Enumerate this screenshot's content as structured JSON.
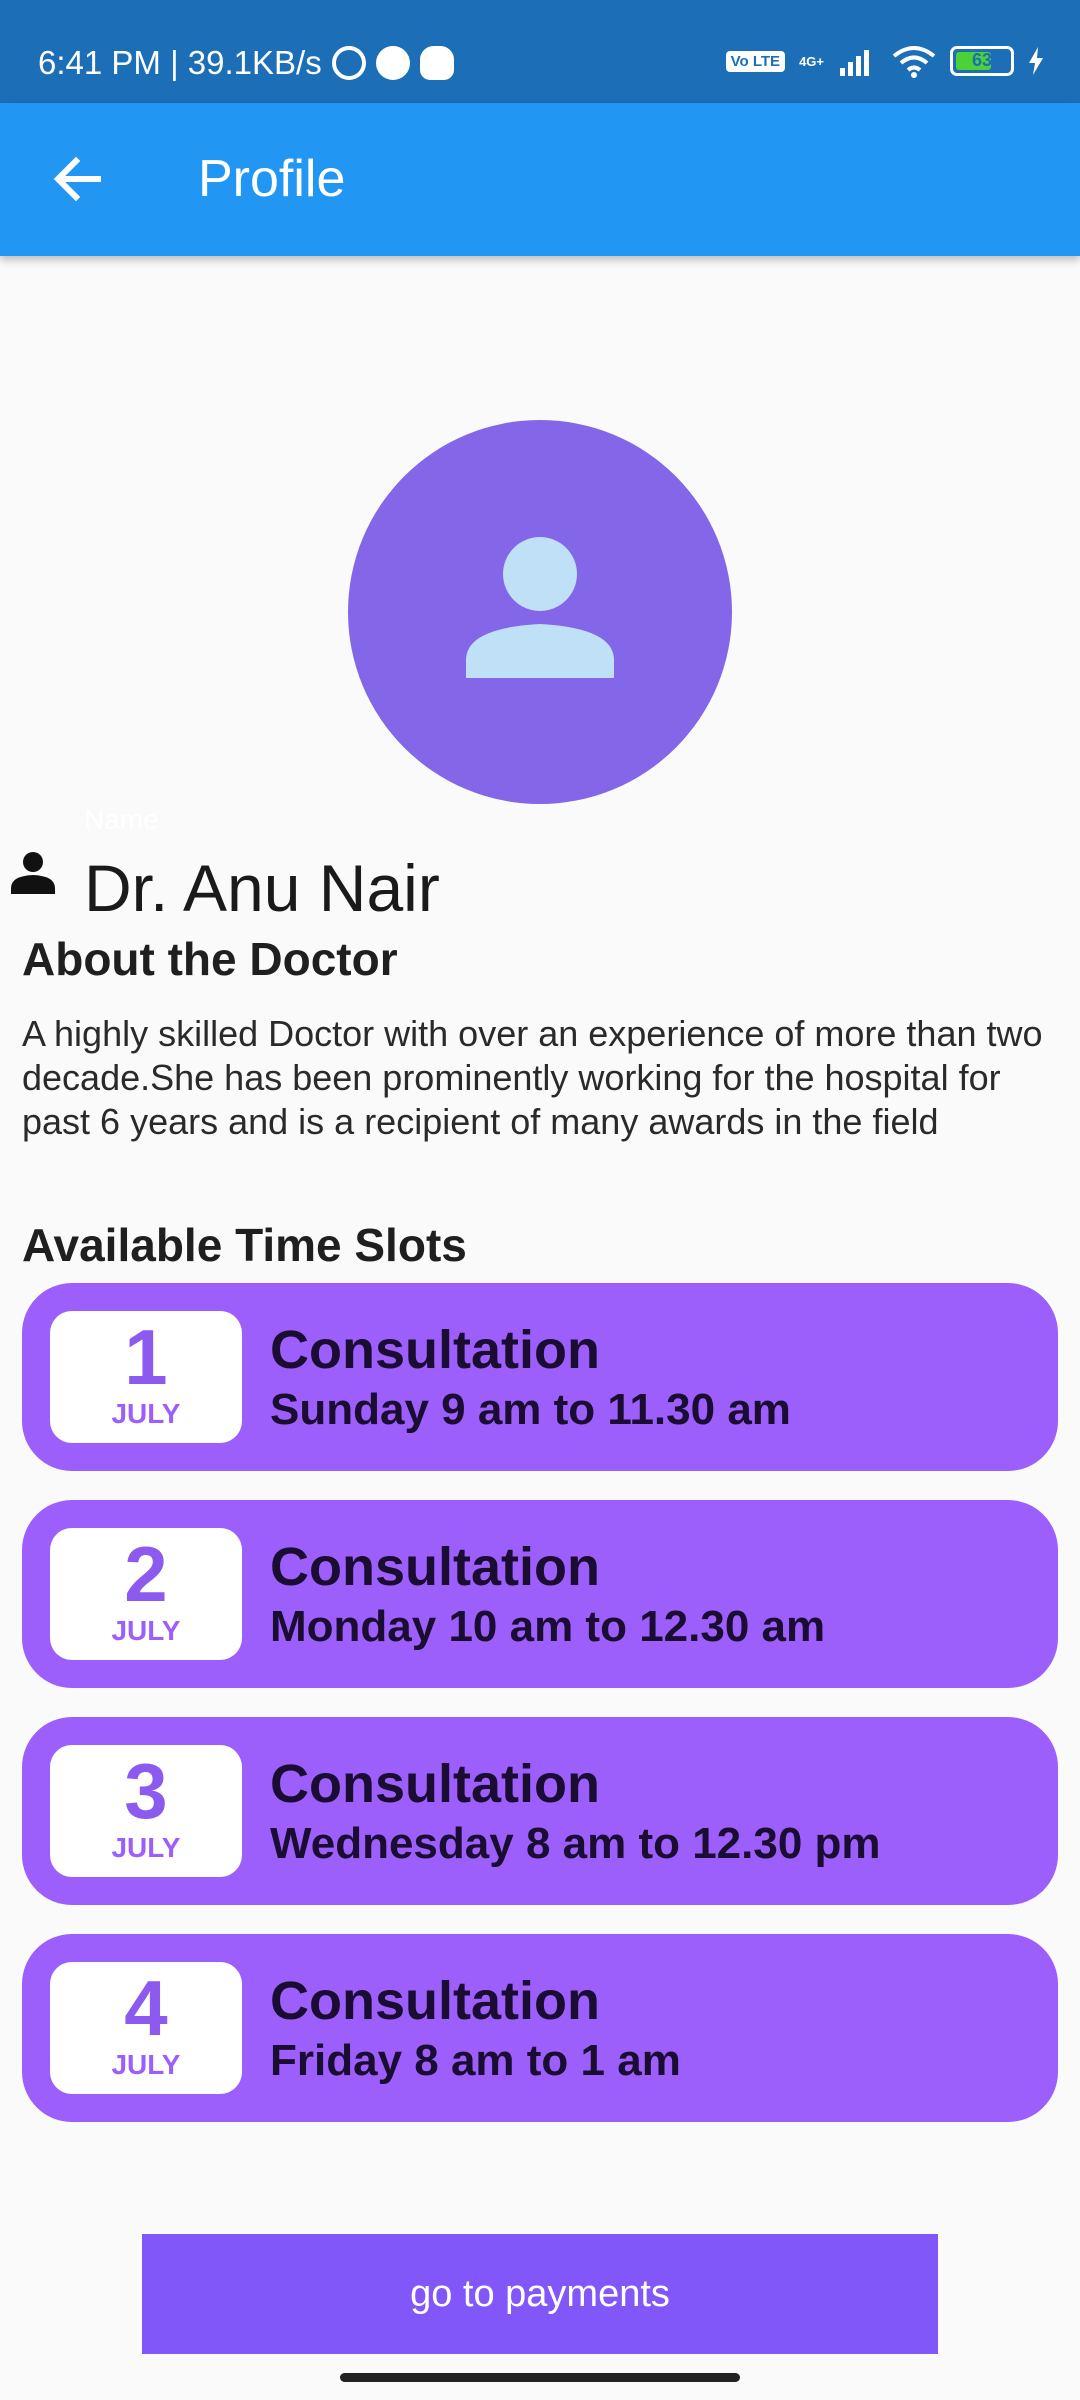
{
  "status_bar": {
    "time": "6:41 PM | 39.1KB/s",
    "network": "4G+",
    "volte": "Vo LTE",
    "battery": "63"
  },
  "app_bar": {
    "title": "Profile"
  },
  "profile": {
    "name_label": "Name",
    "doctor_name": "Dr. Anu Nair",
    "about_heading": "About the Doctor",
    "about_text": "A highly skilled Doctor with over an experience of more than two decade.She has been prominently working for the hospital for past 6 years and is a recipient of many awards in the field"
  },
  "slots": {
    "heading": "Available Time Slots",
    "items": [
      {
        "day": "1",
        "month": "JULY",
        "title": "Consultation",
        "time": "Sunday 9 am to 11.30 am"
      },
      {
        "day": "2",
        "month": "JULY",
        "title": "Consultation",
        "time": "Monday 10 am to 12.30 am"
      },
      {
        "day": "3",
        "month": "JULY",
        "title": "Consultation",
        "time": "Wednesday 8 am to 12.30 pm"
      },
      {
        "day": "4",
        "month": "JULY",
        "title": "Consultation",
        "time": "Friday 8 am to 1 am"
      }
    ]
  },
  "actions": {
    "payments_label": "go to payments"
  },
  "colors": {
    "app_bar": "#2196f3",
    "status_bar": "#1c6fb7",
    "avatar": "#8466e8",
    "slot_card": "#9c5ffb",
    "button": "#8157f9"
  }
}
